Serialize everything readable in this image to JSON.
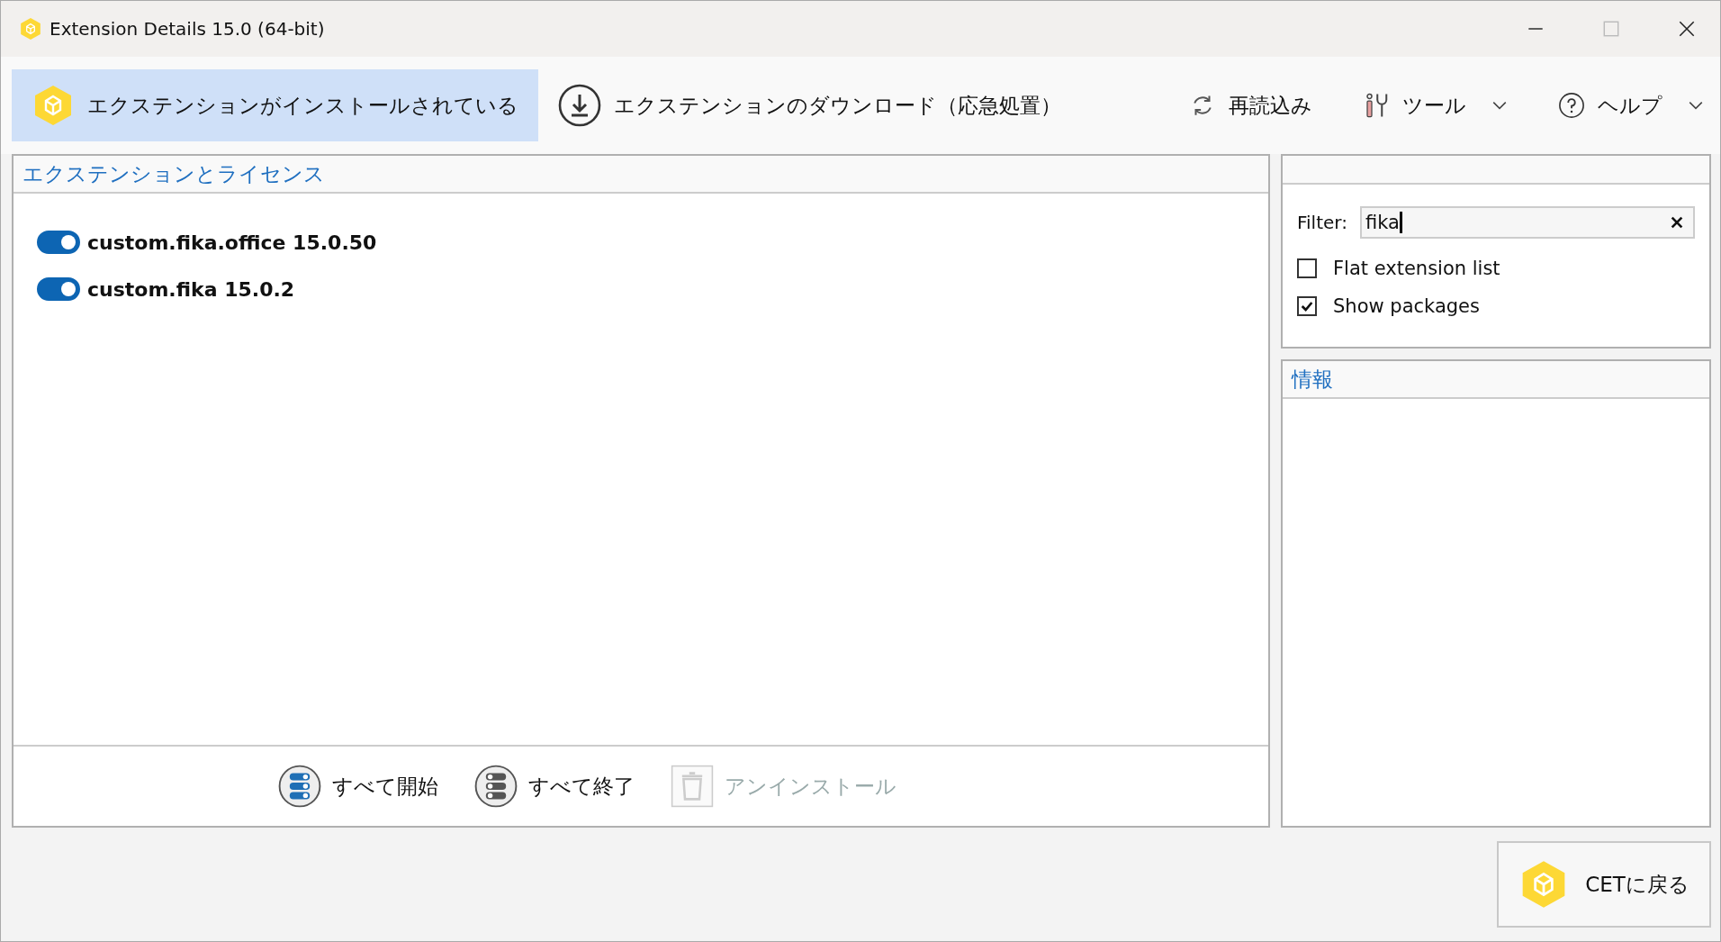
{
  "window": {
    "title": "Extension Details 15.0 (64-bit)"
  },
  "tabs": [
    {
      "label": "エクステンションがインストールされている",
      "selected": true,
      "kind": "installed"
    },
    {
      "label": "エクステンションのダウンロード（応急処置）",
      "selected": false,
      "kind": "download"
    }
  ],
  "toolbar": [
    {
      "label": "再読込み",
      "kind": "reload",
      "dropdown": false
    },
    {
      "label": "ツール",
      "kind": "tools",
      "dropdown": true
    },
    {
      "label": "ヘルプ",
      "kind": "help",
      "dropdown": true
    }
  ],
  "extensions_panel": {
    "title": "エクステンションとライセンス",
    "items": [
      {
        "name": "custom.fika.office 15.0.50",
        "on": true
      },
      {
        "name": "custom.fika 15.0.2",
        "on": true
      }
    ],
    "actions": [
      {
        "label": "すべて開始",
        "kind": "start",
        "disabled": false
      },
      {
        "label": "すべて終了",
        "kind": "stop",
        "disabled": false
      },
      {
        "label": "アンインストール",
        "kind": "uninstall",
        "disabled": true
      }
    ]
  },
  "filter_panel": {
    "filter_label": "Filter:",
    "filter_value": "fika",
    "options": [
      {
        "label": "Flat extension list",
        "checked": false
      },
      {
        "label": "Show packages",
        "checked": true
      }
    ]
  },
  "info_panel": {
    "title": "情報"
  },
  "back_button": {
    "label": "CETに戻る"
  }
}
